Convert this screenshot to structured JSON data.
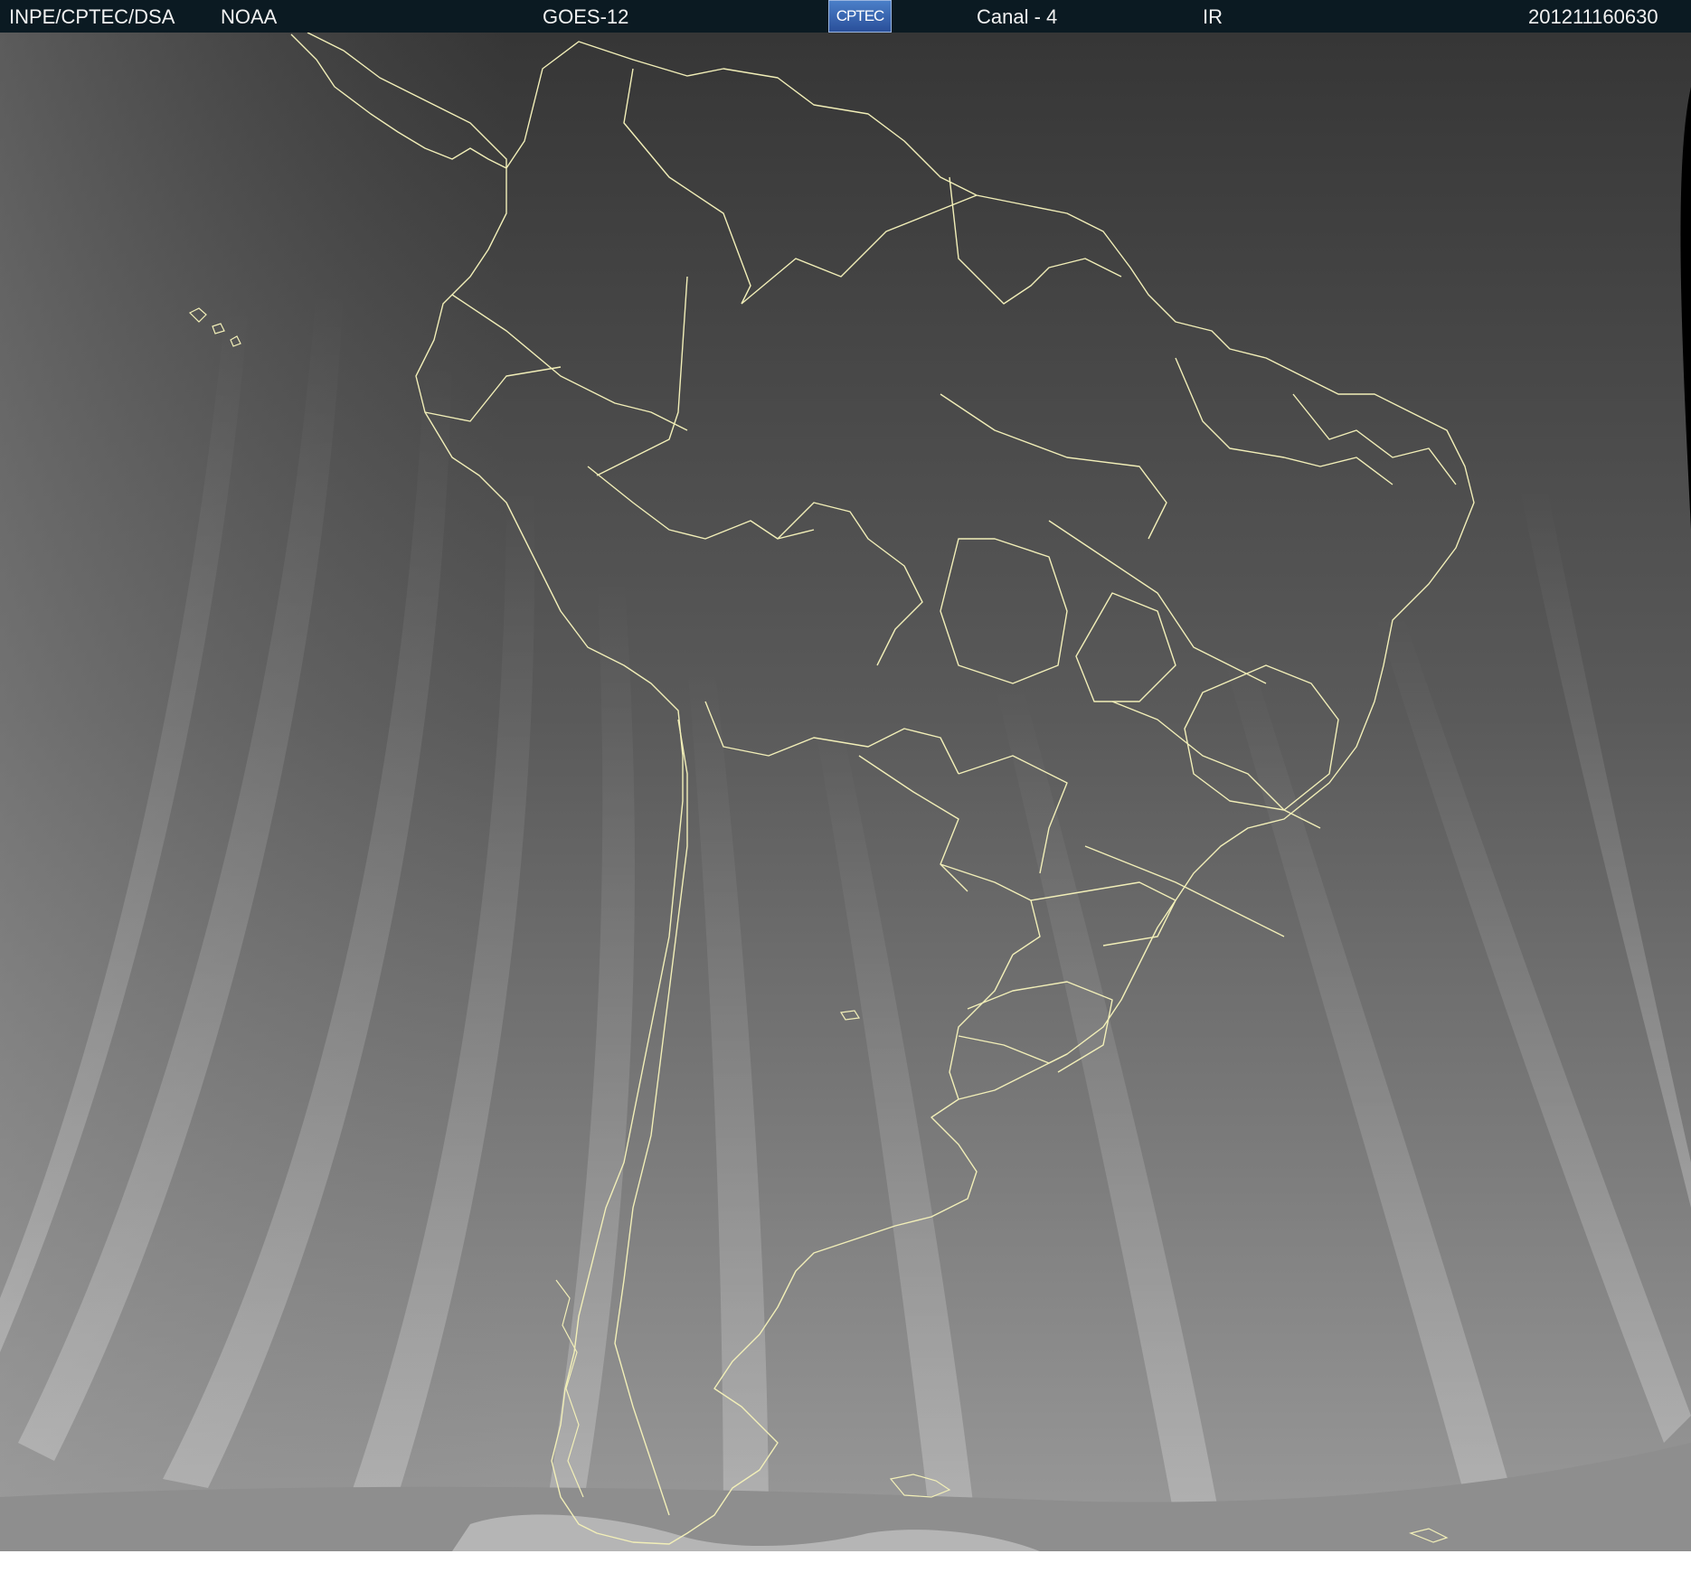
{
  "header": {
    "agency": "INPE/CPTEC/DSA",
    "partner": "NOAA",
    "satellite": "GOES-12",
    "logo_text": "CPTEC",
    "channel": "Canal - 4",
    "band": "IR",
    "timestamp": "201211160630"
  },
  "map": {
    "boundary_color": "#f2efb8",
    "background_dark": "#3a3a3a",
    "background_light": "#9a9a9a"
  }
}
